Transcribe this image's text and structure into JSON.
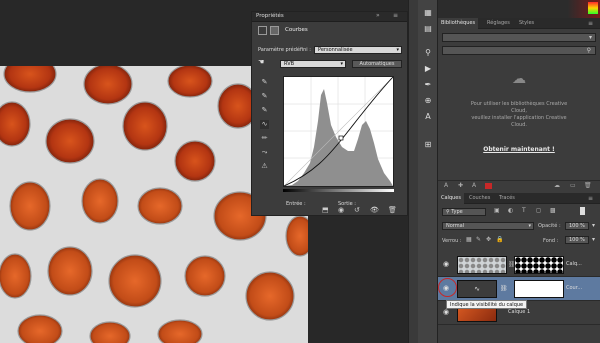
{
  "colors": {
    "accent": "#5e7aa0",
    "selection_ring": "#c62828"
  },
  "properties_panel": {
    "title": "Propriétés",
    "section": "Courbes",
    "preset_label": "Paramètre prédéfini :",
    "preset_value": "Personnalisée",
    "channel_value": "RVB",
    "auto_button": "Automatiques",
    "input_label": "Entrée :",
    "output_label": "Sortie :"
  },
  "libraries_panel": {
    "tabs": [
      "Bibliothèques",
      "Réglages",
      "Styles"
    ],
    "message_line1": "Pour utiliser les bibliothèques Creative",
    "message_line2": "Cloud,",
    "message_line3": "veuillez installer l'application Creative",
    "message_line4": "Cloud.",
    "cta": "Obtenir maintenant !"
  },
  "layers_panel": {
    "tabs": [
      "Calques",
      "Couches",
      "Tracés"
    ],
    "filter_value": "Type",
    "blend_mode": "Normal",
    "opacity_label": "Opacité :",
    "opacity_value": "100 %",
    "lock_label": "Verrou :",
    "fill_label": "Fond :",
    "fill_value": "100 %",
    "layers": [
      {
        "name": "Calq..."
      },
      {
        "name": "Cour..."
      },
      {
        "name": "Calque 1"
      }
    ],
    "tooltip": "Indique la visibilité du calque"
  }
}
